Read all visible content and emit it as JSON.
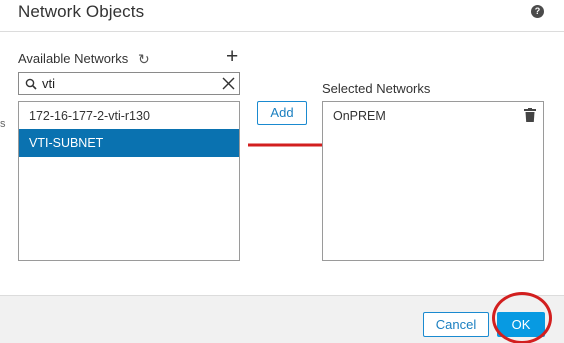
{
  "dialog": {
    "title": "Network Objects",
    "help_icon": "question-circle-icon"
  },
  "left_edge_char": "s",
  "available": {
    "label": "Available Networks",
    "refresh_icon": "refresh-icon",
    "add_icon": "plus-icon",
    "search": {
      "value": "vti",
      "search_icon": "magnifier-icon",
      "clear_icon": "close-icon"
    },
    "items": [
      {
        "label": "172-16-177-2-vti-r130",
        "selected": false
      },
      {
        "label": "VTI-SUBNET",
        "selected": true
      }
    ]
  },
  "add_button": "Add",
  "selected": {
    "label": "Selected Networks",
    "items": [
      {
        "label": "OnPREM",
        "delete_icon": "trash-icon"
      }
    ]
  },
  "annotation": {
    "arrow_color": "#d21f1f",
    "circle_color": "#d21f1f"
  },
  "footer": {
    "cancel_label": "Cancel",
    "ok_label": "OK"
  },
  "colors": {
    "selected_row": "#0a72b0",
    "primary_button": "#079ae2",
    "link_blue": "#1a7fc0"
  }
}
